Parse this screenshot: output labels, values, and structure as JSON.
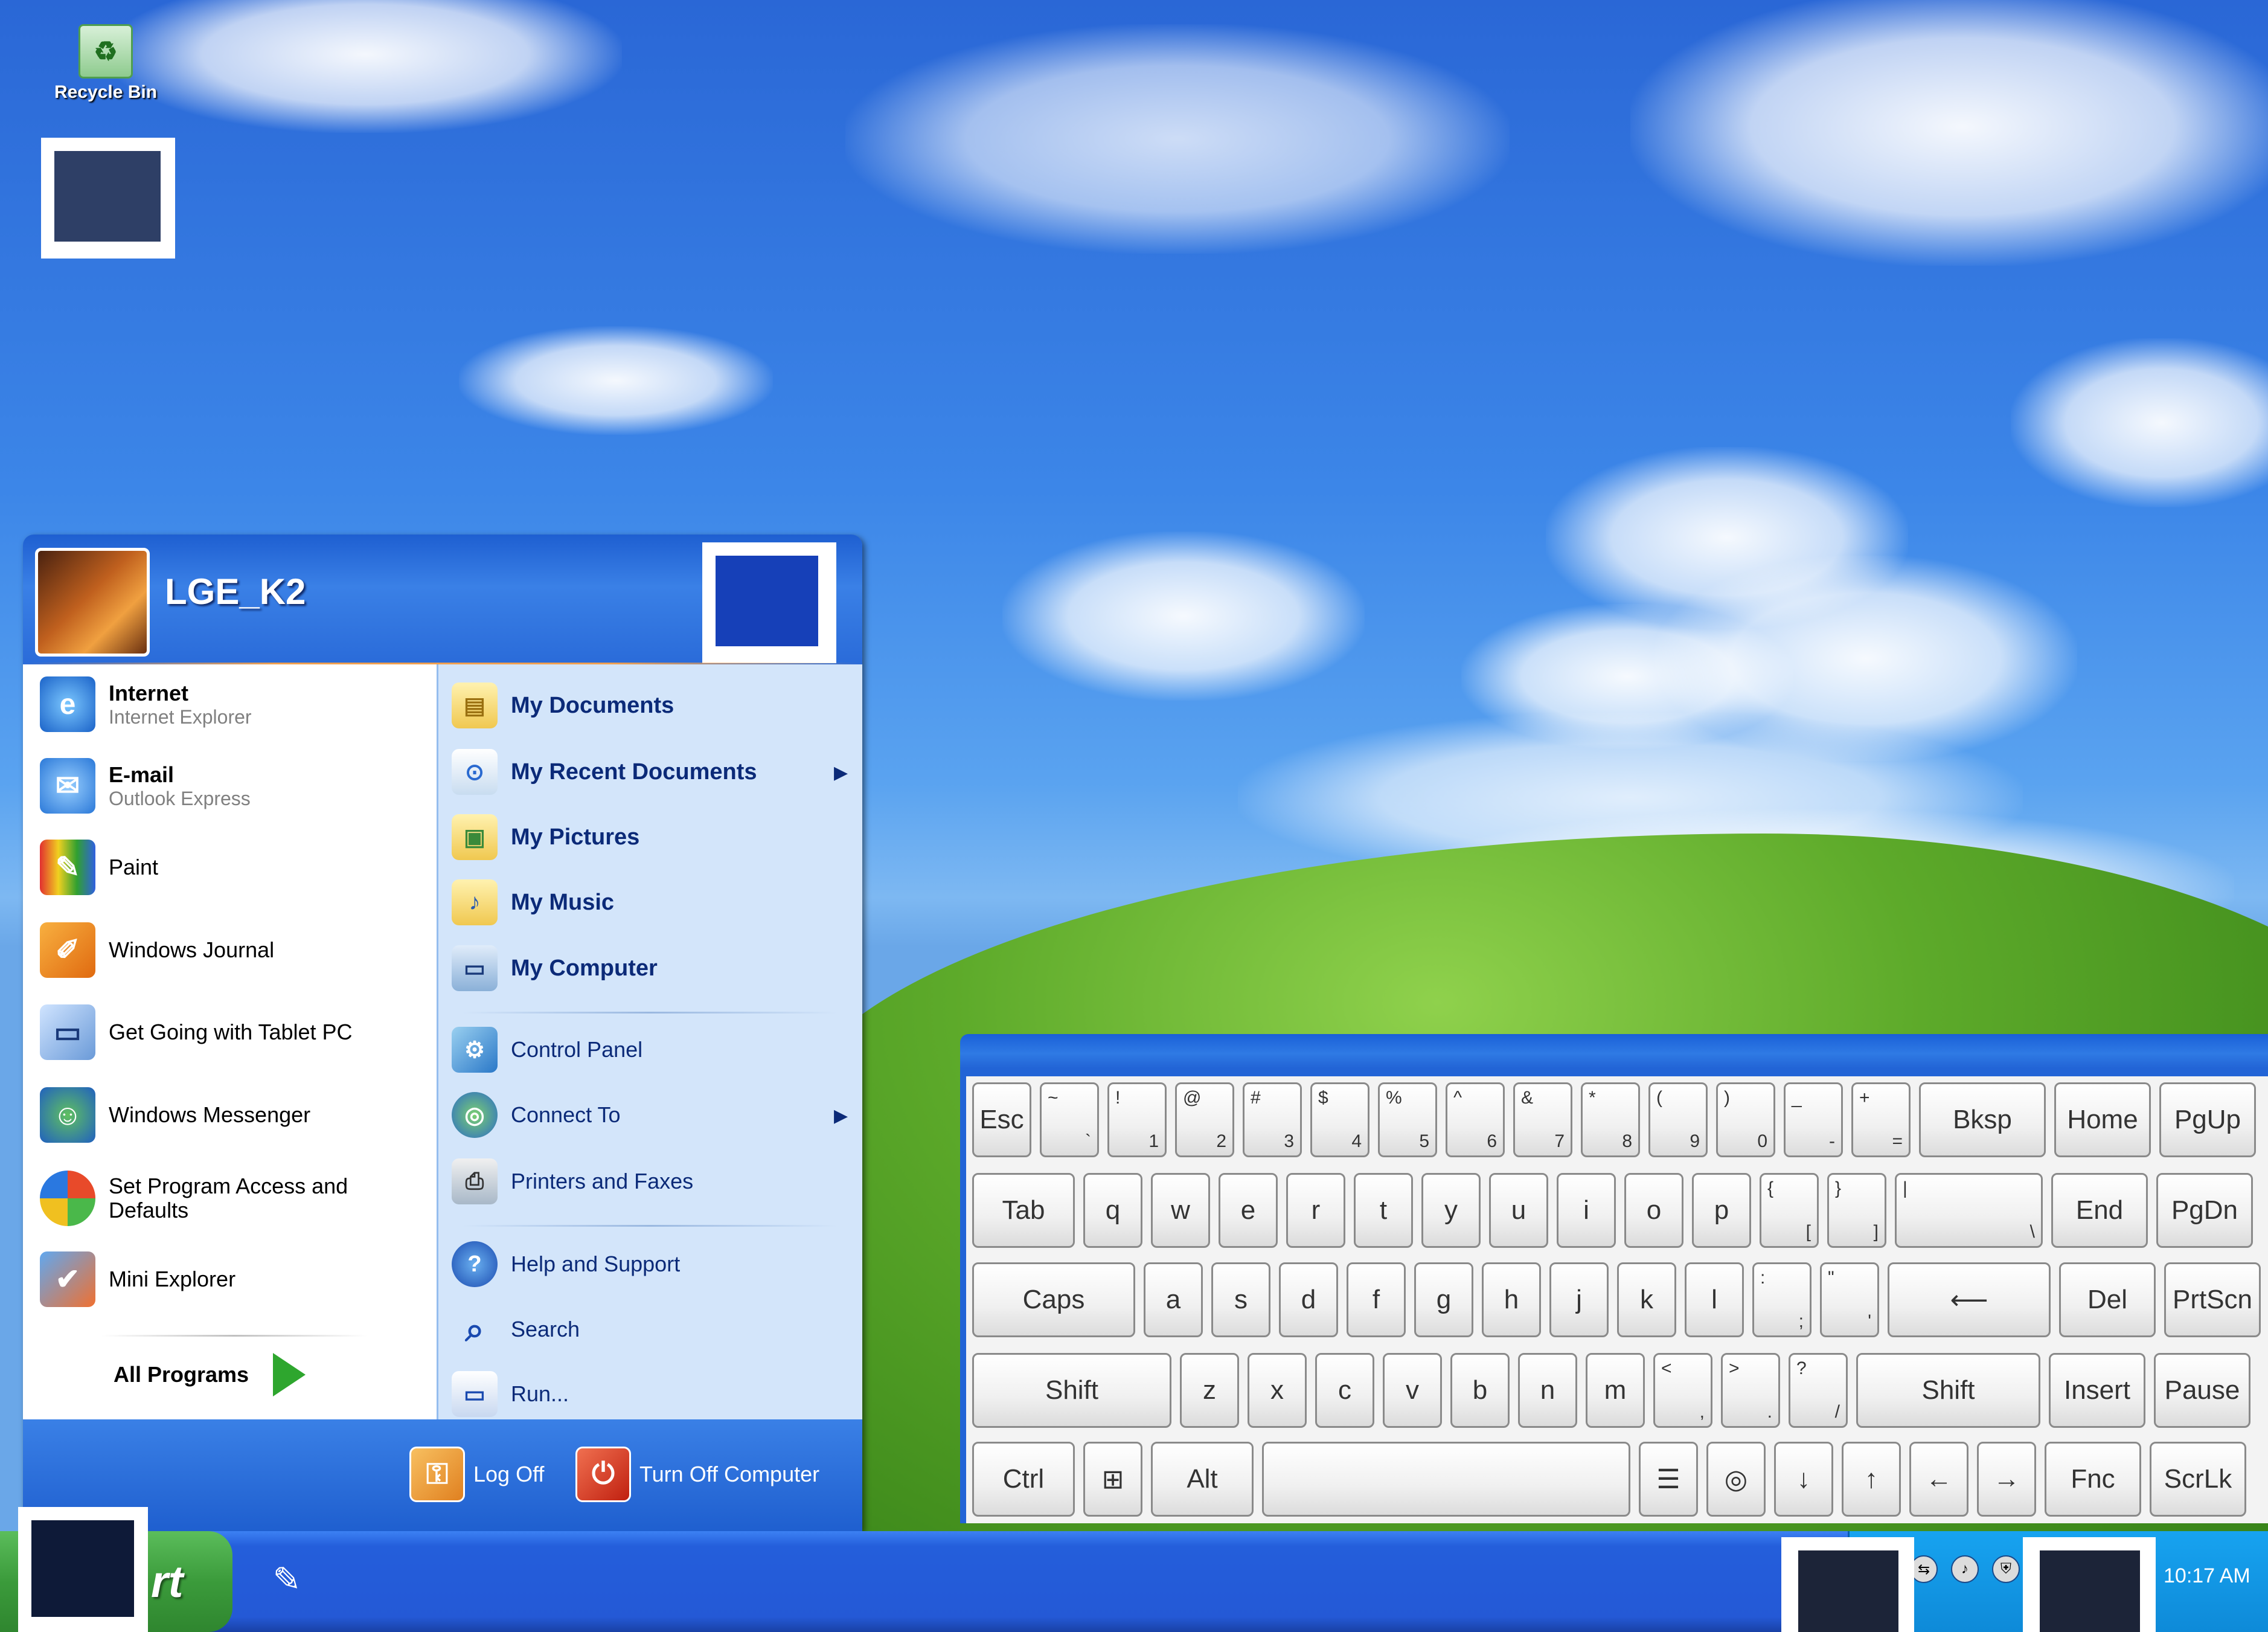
{
  "desktop": {
    "recycle_bin_label": "Recycle Bin"
  },
  "start_menu": {
    "user_name": "LGE_K2",
    "left_items": [
      {
        "title": "Internet",
        "subtitle": "Internet Explorer",
        "icon": "internet-explorer-icon"
      },
      {
        "title": "E-mail",
        "subtitle": "Outlook Express",
        "icon": "outlook-express-icon"
      },
      {
        "title": "Paint",
        "icon": "paint-icon"
      },
      {
        "title": "Windows Journal",
        "icon": "journal-icon"
      },
      {
        "title": "Get Going with Tablet PC",
        "icon": "tablet-pc-icon"
      },
      {
        "title": "Windows Messenger",
        "icon": "messenger-icon"
      },
      {
        "title": "Set Program Access and Defaults",
        "icon": "program-access-icon"
      },
      {
        "title": "Mini Explorer",
        "icon": "mini-explorer-icon"
      }
    ],
    "all_programs_label": "All Programs",
    "right_items": [
      {
        "label": "My Documents",
        "icon": "folder-icon"
      },
      {
        "label": "My Recent Documents",
        "icon": "recent-documents-icon",
        "submenu": true
      },
      {
        "label": "My Pictures",
        "icon": "pictures-folder-icon"
      },
      {
        "label": "My Music",
        "icon": "music-folder-icon"
      },
      {
        "label": "My Computer",
        "icon": "computer-icon"
      },
      {
        "label": "Control Panel",
        "icon": "control-panel-icon"
      },
      {
        "label": "Connect To",
        "icon": "connect-to-icon",
        "submenu": true
      },
      {
        "label": "Printers and Faxes",
        "icon": "printer-icon"
      },
      {
        "label": "Help and Support",
        "icon": "help-icon"
      },
      {
        "label": "Search",
        "icon": "search-icon"
      },
      {
        "label": "Run...",
        "icon": "run-icon"
      }
    ],
    "log_off_label": "Log Off",
    "turn_off_label": "Turn Off Computer"
  },
  "taskbar": {
    "start_label": "rt",
    "clock": "10:17 AM"
  },
  "keyboard": {
    "row1": [
      {
        "main": "Esc"
      },
      {
        "shift": "~",
        "base": "`"
      },
      {
        "shift": "!",
        "base": "1"
      },
      {
        "shift": "@",
        "base": "2"
      },
      {
        "shift": "#",
        "base": "3"
      },
      {
        "shift": "$",
        "base": "4"
      },
      {
        "shift": "%",
        "base": "5"
      },
      {
        "shift": "^",
        "base": "6"
      },
      {
        "shift": "&",
        "base": "7"
      },
      {
        "shift": "*",
        "base": "8"
      },
      {
        "shift": "(",
        "base": "9"
      },
      {
        "shift": ")",
        "base": "0"
      },
      {
        "shift": "_",
        "base": "-"
      },
      {
        "shift": "+",
        "base": "="
      },
      {
        "main": "Bksp"
      },
      {
        "main": "Home"
      },
      {
        "main": "PgUp"
      }
    ],
    "row2": [
      {
        "main": "Tab"
      },
      {
        "main": "q"
      },
      {
        "main": "w"
      },
      {
        "main": "e"
      },
      {
        "main": "r"
      },
      {
        "main": "t"
      },
      {
        "main": "y"
      },
      {
        "main": "u"
      },
      {
        "main": "i"
      },
      {
        "main": "o"
      },
      {
        "main": "p"
      },
      {
        "shift": "{",
        "base": "["
      },
      {
        "shift": "}",
        "base": "]"
      },
      {
        "shift": "|",
        "base": "\\"
      },
      {
        "main": "End"
      },
      {
        "main": "PgDn"
      }
    ],
    "row3": [
      {
        "main": "Caps"
      },
      {
        "main": "a"
      },
      {
        "main": "s"
      },
      {
        "main": "d"
      },
      {
        "main": "f"
      },
      {
        "main": "g"
      },
      {
        "main": "h"
      },
      {
        "main": "j"
      },
      {
        "main": "k"
      },
      {
        "main": "l"
      },
      {
        "shift": ":",
        "base": ";"
      },
      {
        "shift": "\"",
        "base": "'"
      },
      {
        "main": "⟵"
      },
      {
        "main": "Del"
      },
      {
        "main": "PrtScn"
      }
    ],
    "row4": [
      {
        "main": "Shift"
      },
      {
        "main": "z"
      },
      {
        "main": "x"
      },
      {
        "main": "c"
      },
      {
        "main": "v"
      },
      {
        "main": "b"
      },
      {
        "main": "n"
      },
      {
        "main": "m"
      },
      {
        "shift": "<",
        "base": ","
      },
      {
        "shift": ">",
        "base": "."
      },
      {
        "shift": "?",
        "base": "/"
      },
      {
        "main": "Shift"
      },
      {
        "main": "Insert"
      },
      {
        "main": "Pause"
      }
    ],
    "row5": [
      {
        "main": "Ctrl"
      },
      {
        "main": "⊞"
      },
      {
        "main": "Alt"
      },
      {
        "main": ""
      },
      {
        "main": "☰"
      },
      {
        "main": "◎"
      },
      {
        "main": "↓"
      },
      {
        "main": "↑"
      },
      {
        "main": "←"
      },
      {
        "main": "→"
      },
      {
        "main": "Fnc"
      },
      {
        "main": "ScrLk"
      }
    ]
  }
}
